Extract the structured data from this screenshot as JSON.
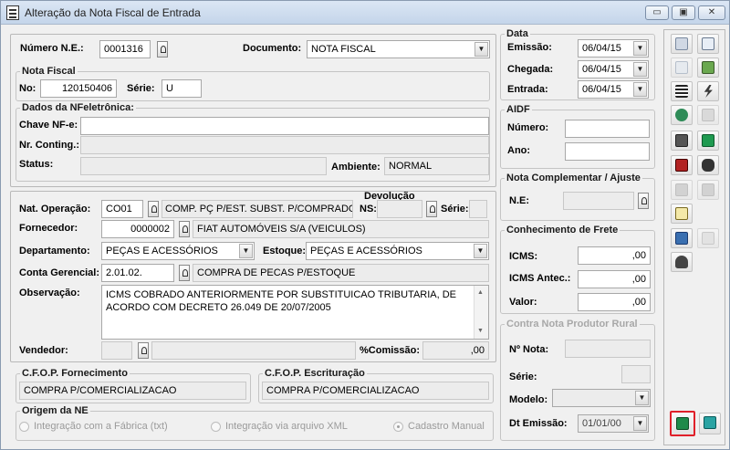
{
  "window": {
    "title": "Alteração da Nota Fiscal de Entrada",
    "buttons": {
      "minimize": "▭",
      "restore": "▣",
      "close": "✕"
    }
  },
  "header": {
    "numero_ne_label": "Número N.E.:",
    "numero_ne_value": "0001316",
    "documento_label": "Documento:",
    "documento_value": "NOTA FISCAL"
  },
  "nota_fiscal": {
    "legend": "Nota Fiscal",
    "no_label": "No:",
    "no_value": "120150406",
    "serie_label": "Série:",
    "serie_value": "U"
  },
  "nfe": {
    "legend": "Dados da NFeletrônica:",
    "chave_label": "Chave NF-e:",
    "chave_value": "",
    "contig_label": "Nr. Conting.:",
    "contig_value": "",
    "status_label": "Status:",
    "status_value": "",
    "ambiente_label": "Ambiente:",
    "ambiente_value": "NORMAL"
  },
  "data": {
    "legend": "Data",
    "emissao_label": "Emissão:",
    "emissao_value": "06/04/15",
    "chegada_label": "Chegada:",
    "chegada_value": "06/04/15",
    "entrada_label": "Entrada:",
    "entrada_value": "06/04/15"
  },
  "aidf": {
    "legend": "AIDF",
    "numero_label": "Número:",
    "numero_value": "",
    "ano_label": "Ano:",
    "ano_value": ""
  },
  "complementar": {
    "legend": "Nota Complementar / Ajuste",
    "ne_label": "N.E:",
    "ne_value": ""
  },
  "operacao": {
    "nat_label": "Nat. Operação:",
    "nat_code": "CO01",
    "nat_desc": "COMP. PÇ P/EST. SUBST. P/COMPRADO",
    "devolucao_label": "Devolução",
    "ns_label": "NS:",
    "ns_value": "",
    "serie_label": "Série:",
    "serie_value": "",
    "fornecedor_label": "Fornecedor:",
    "fornecedor_code": "0000002",
    "fornecedor_name": "FIAT AUTOMÓVEIS S/A (VEICULOS)",
    "departamento_label": "Departamento:",
    "departamento_value": "PEÇAS E ACESSÓRIOS",
    "estoque_label": "Estoque:",
    "estoque_value": "PEÇAS E ACESSÓRIOS",
    "conta_label": "Conta Gerencial:",
    "conta_code": "2.01.02.",
    "conta_desc": "COMPRA DE PECAS P/ESTOQUE",
    "obs_label": "Observação:",
    "obs_value": "ICMS COBRADO ANTERIORMENTE POR SUBSTITUICAO TRIBUTARIA, DE ACORDO COM DECRETO 26.049 DE 20/07/2005",
    "vendedor_label": "Vendedor:",
    "vendedor_code": "",
    "vendedor_name": "",
    "comissao_label": "%Comissão:",
    "comissao_value": ",00"
  },
  "frete": {
    "legend": "Conhecimento de Frete",
    "icms_label": "ICMS:",
    "icms_value": ",00",
    "icms_antec_label": "ICMS Antec.:",
    "icms_antec_value": ",00",
    "valor_label": "Valor:",
    "valor_value": ",00"
  },
  "cfop": {
    "fornecimento_legend": "C.F.O.P. Fornecimento",
    "fornecimento_value": "COMPRA P/COMERCIALIZACAO",
    "escrituracao_legend": "C.F.O.P. Escrituração",
    "escrituracao_value": "COMPRA P/COMERCIALIZACAO"
  },
  "origem": {
    "legend": "Origem da NE",
    "options": [
      "Integração com a Fábrica (txt)",
      "Integração via arquivo XML",
      "Cadastro Manual"
    ],
    "selected": "Cadastro Manual"
  },
  "produtor": {
    "legend": "Contra Nota Produtor Rural",
    "nota_label": "Nº Nota:",
    "nota_value": "",
    "serie_label": "Série:",
    "serie_value": "",
    "modelo_label": "Modelo:",
    "modelo_value": "",
    "emissao_label": "Dt Emissão:",
    "emissao_value": "01/01/00"
  },
  "toolbar_icons": [
    "add-item-icon",
    "grid-icon",
    "preview-icon",
    "image-icon",
    "list-icon",
    "lightning-icon",
    "refresh-icon",
    "trash-icon",
    "print-icon",
    "transfer-icon",
    "tv-icon",
    "hand-icon",
    "print-disabled-icon",
    "print-disabled-2-icon",
    "document-icon",
    "import-icon",
    "folder-icon",
    "group-icon",
    "confirm-icon",
    "exit-icon"
  ],
  "colors": {
    "highlight": "#e0202a",
    "title_bar": "#c4d5ea",
    "form_bg": "#f0f0f0"
  }
}
